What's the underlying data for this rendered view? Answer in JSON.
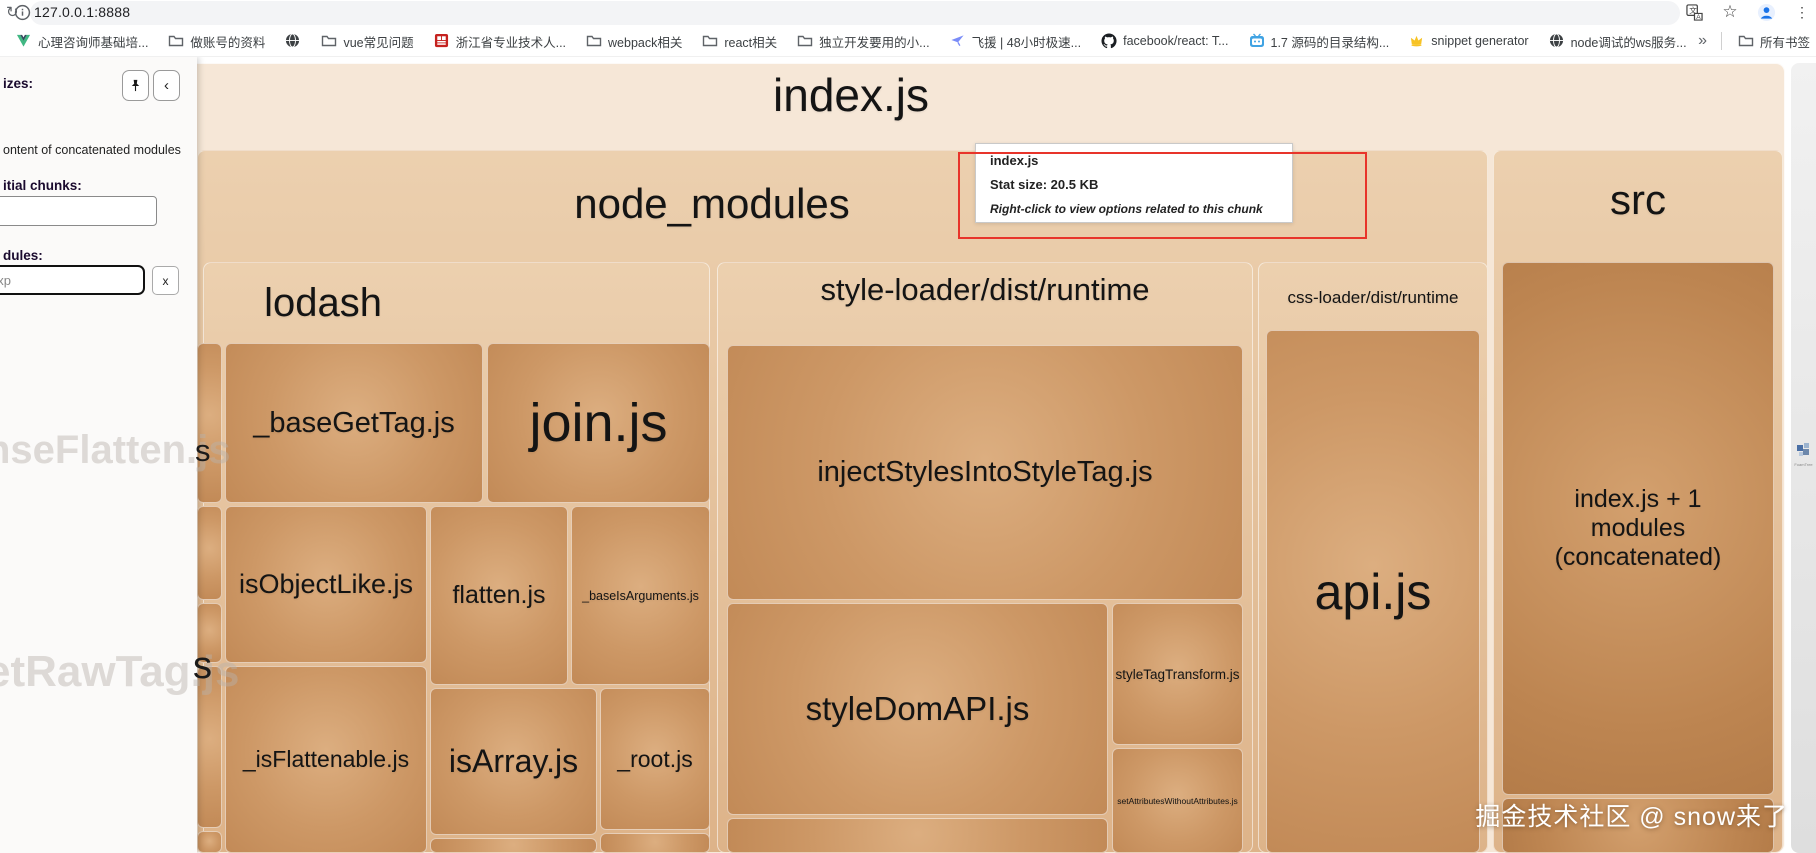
{
  "browser": {
    "url": "127.0.0.1:8888",
    "bookmarks": [
      {
        "icon": "vue-icon",
        "label": "心理咨询师基础培..."
      },
      {
        "icon": "folder-icon",
        "label": "做账号的资料"
      },
      {
        "icon": "globe-dark-icon",
        "label": ""
      },
      {
        "icon": "folder-icon",
        "label": "vue常见问题"
      },
      {
        "icon": "seal-red-icon",
        "label": "浙江省专业技术人..."
      },
      {
        "icon": "folder-icon",
        "label": "webpack相关"
      },
      {
        "icon": "folder-icon",
        "label": "react相关"
      },
      {
        "icon": "folder-icon",
        "label": "独立开发要用的小..."
      },
      {
        "icon": "kite-icon",
        "label": "飞援 | 48小时极速..."
      },
      {
        "icon": "github-icon",
        "label": "facebook/react: T..."
      },
      {
        "icon": "tv-blue-icon",
        "label": "1.7 源码的目录结构..."
      },
      {
        "icon": "crown-icon",
        "label": "snippet generator"
      },
      {
        "icon": "globe-dark-icon",
        "label": "node调试的ws服务..."
      }
    ],
    "overflow_chevron": "»",
    "all_bookmarks_label": "所有书签"
  },
  "sidebar": {
    "sizes_label": "izes:",
    "concat_label": "ontent of concatenated modules",
    "initial_chunks_label": "itial chunks:",
    "search_chunks_value": "",
    "modules_label": "dules:",
    "search_modules_value": "exp",
    "clear_button_label": "x",
    "collapse_icon": "‹",
    "ghost_label_1": "nseFlatten.js",
    "ghost_label_2": "etRawTag.js",
    "edge_tail_1": "s",
    "edge_tail_2": "s"
  },
  "treemap": {
    "labels": {
      "chunk_index": "index.js",
      "node_modules": "node_modules",
      "lodash": "lodash",
      "style_loader": "style-loader/dist/runtime",
      "css_loader": "css-loader/dist/runtime",
      "src": "src",
      "base_get_tag": "_baseGetTag.js",
      "join": "join.js",
      "is_object_like": "isObjectLike.js",
      "flatten": "flatten.js",
      "base_is_arguments": "_baseIsArguments.js",
      "is_flattenable": "_isFlattenable.js",
      "is_array": "isArray.js",
      "root": "_root.js",
      "inject_styles": "injectStylesIntoStyleTag.js",
      "style_dom_api": "styleDomAPI.js",
      "style_tag_transform": "styleTagTransform.js",
      "set_attributes": "setAttributesWithoutAttributes.js",
      "api": "api.js",
      "src_concat": "index.js + 1 modules (concatenated)"
    }
  },
  "tooltip": {
    "title": "index.js",
    "stat": "Stat size: 20.5 KB",
    "hint": "Right-click to view options related to this chunk"
  },
  "watermark": "掘金技术社区 @ snow来了",
  "foamtree_label": "FoamTree"
}
